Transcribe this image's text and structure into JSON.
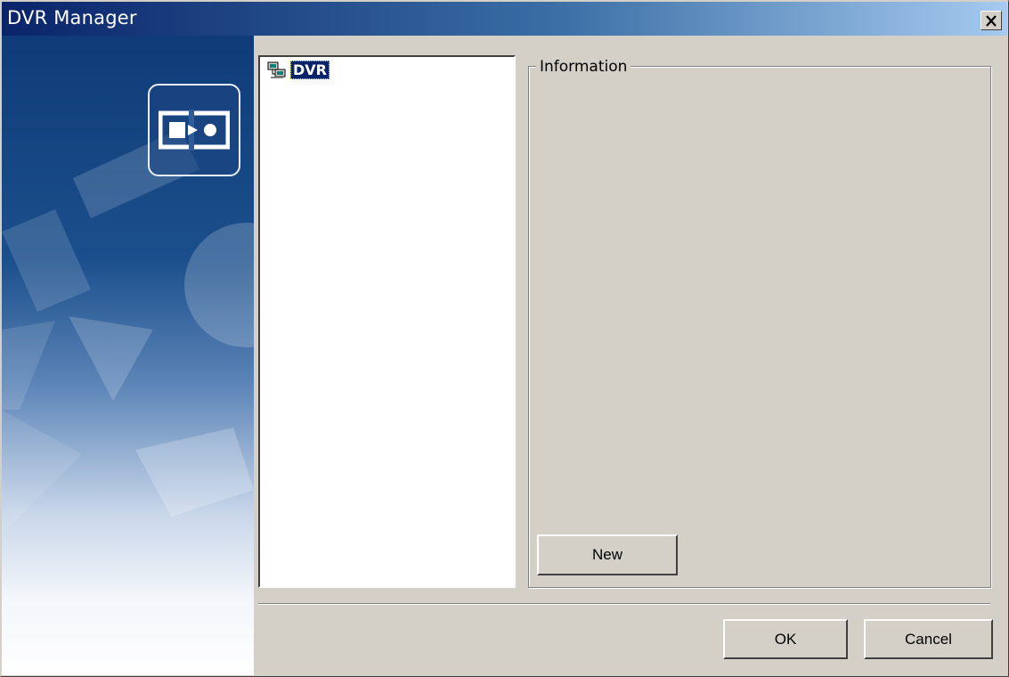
{
  "window": {
    "title": "DVR Manager"
  },
  "icons": {
    "close": "close-icon",
    "app_badge": "dvr-manager-logo-icon",
    "tree_node": "dvr-network-icon"
  },
  "tree": {
    "items": [
      {
        "label": "DVR",
        "selected": true
      }
    ]
  },
  "info_group": {
    "label": "Information",
    "new_button": "New"
  },
  "footer": {
    "ok_label": "OK",
    "cancel_label": "Cancel"
  },
  "colors": {
    "title_start": "#0a246a",
    "title_end": "#a6caf0",
    "selection": "#0a246a",
    "face": "#d4d0c8"
  }
}
